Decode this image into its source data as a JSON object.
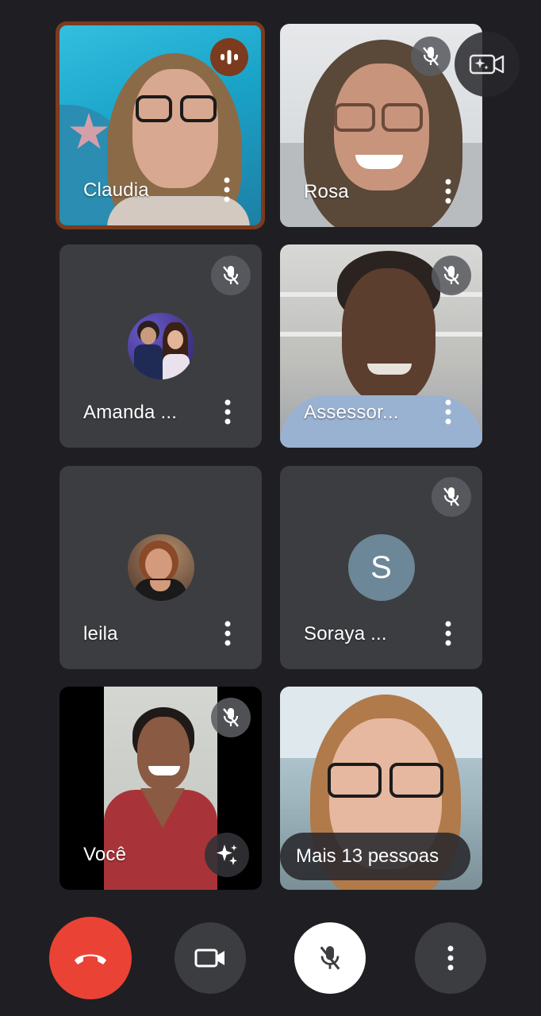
{
  "participants": [
    {
      "name": "Claudia",
      "state": "speaking"
    },
    {
      "name": "Rosa",
      "state": "muted"
    },
    {
      "name": "Amanda ...",
      "state": "muted"
    },
    {
      "name": "Assessor...",
      "state": "muted"
    },
    {
      "name": "leila",
      "state": "unmuted"
    },
    {
      "name": "Soraya ...",
      "state": "muted",
      "avatar_letter": "S"
    },
    {
      "name": "Você",
      "state": "muted"
    }
  ],
  "more_people_label": "Mais 13 pessoas",
  "colors": {
    "background": "#1f1f23",
    "tile": "#3c3d41",
    "speaking": "#7c3b1e",
    "end_call": "#ea4335",
    "avatar_letter_bg": "#6c8797"
  },
  "icons": {
    "end_call": "phone-hangup-icon",
    "camera": "video-camera-icon",
    "mic": "mic-off-icon",
    "more": "more-vert-icon",
    "effects": "camera-sparkle-icon"
  }
}
